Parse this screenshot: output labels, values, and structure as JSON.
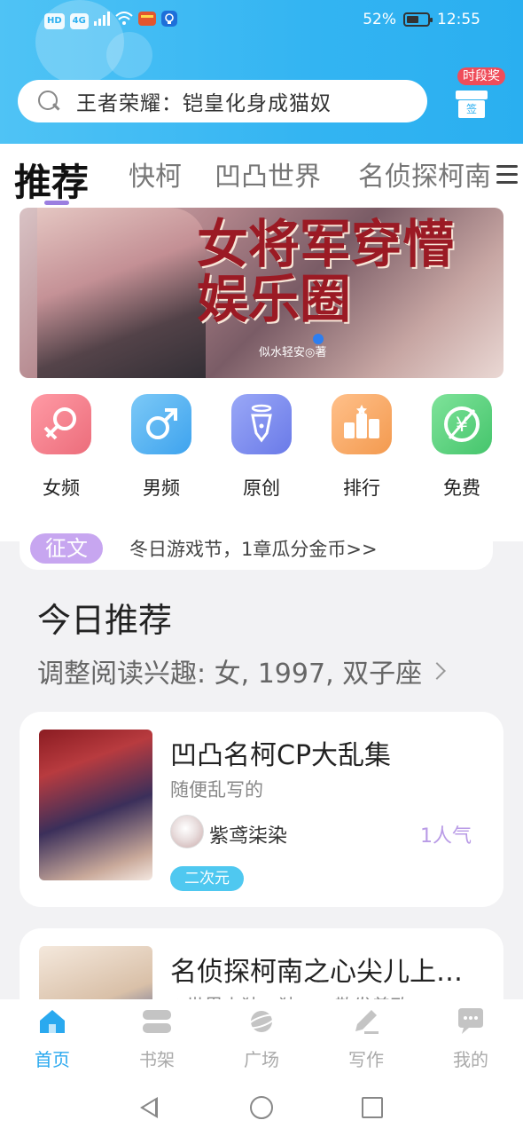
{
  "status_bar": {
    "left_icons": [
      "HD",
      "4G",
      "signal-icon",
      "wifi-icon",
      "app-notification-icon",
      "bulb-icon"
    ],
    "battery": "52%",
    "time": "12:55"
  },
  "search": {
    "placeholder": "王者荣耀：铠皇化身成猫奴"
  },
  "gift": {
    "badge": "时段奖",
    "label": "签"
  },
  "tabs": {
    "items": [
      {
        "label": "推荐",
        "active": true
      },
      {
        "label": "快柯",
        "active": false
      },
      {
        "label": "凹凸世界",
        "active": false
      },
      {
        "label": "名侦探柯南",
        "active": false
      }
    ]
  },
  "banner": {
    "title": "女将军穿懵娱乐圈",
    "author": "似水轻安◎著"
  },
  "categories": [
    {
      "label": "女频",
      "icon": "female-icon",
      "color": "#f07c86"
    },
    {
      "label": "男频",
      "icon": "male-icon",
      "color": "#5bb5f0"
    },
    {
      "label": "原创",
      "icon": "pen-icon",
      "color": "#7b8df0"
    },
    {
      "label": "排行",
      "icon": "ranking-icon",
      "color": "#f6a65c"
    },
    {
      "label": "免费",
      "icon": "free-icon",
      "color": "#5bd67e"
    }
  ],
  "notice": {
    "tag": "征文",
    "text": "冬日游戏节，1章瓜分金币>>"
  },
  "section": {
    "title": "今日推荐",
    "interest": "调整阅读兴趣: 女, 1997, 双子座"
  },
  "books": [
    {
      "title": "凹凸名柯CP大乱集",
      "desc": "随便乱写的",
      "author": "紫鸢柒染",
      "popularity": "1人气",
      "tag": "二次元"
    },
    {
      "title": "名侦探柯南之心尖儿上…",
      "desc": "✦世界上独一独二，散发着致"
    }
  ],
  "bottom_nav": [
    {
      "label": "首页",
      "icon": "home-icon",
      "active": true
    },
    {
      "label": "书架",
      "icon": "bookshelf-icon",
      "active": false
    },
    {
      "label": "广场",
      "icon": "planet-icon",
      "active": false
    },
    {
      "label": "写作",
      "icon": "write-icon",
      "active": false
    },
    {
      "label": "我的",
      "icon": "chat-icon",
      "active": false
    }
  ],
  "colors": {
    "accent": "#2aa9ef",
    "tab_indicator": "#9b7ee0",
    "popularity": "#b99be6",
    "tag": "#4fc8f0"
  }
}
